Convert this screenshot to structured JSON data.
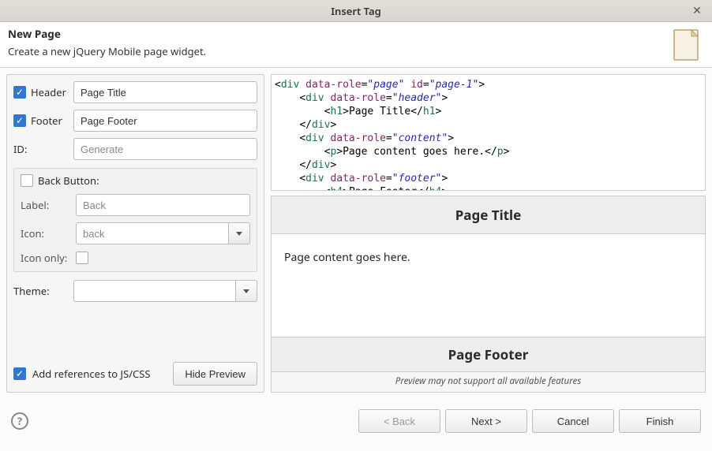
{
  "titlebar": {
    "title": "Insert Tag"
  },
  "banner": {
    "heading": "New Page",
    "subtext": "Create a new jQuery Mobile page widget."
  },
  "form": {
    "header_label": "Header",
    "header_value": "Page Title",
    "footer_label": "Footer",
    "footer_value": "Page Footer",
    "id_label": "ID:",
    "id_placeholder": "Generate",
    "backbutton_label": "Back Button:",
    "label_label": "Label:",
    "label_placeholder": "Back",
    "icon_label": "Icon:",
    "icon_value": "back",
    "icononly_label": "Icon only:",
    "theme_label": "Theme:",
    "theme_value": "",
    "add_refs_label": "Add references to JS/CSS",
    "hide_preview_label": "Hide Preview"
  },
  "code": {
    "l1_attr1": "data-role",
    "l1_val1": "page",
    "l1_attr2": "id",
    "l1_val2": "page-1",
    "l2_val": "header",
    "l3_txt": "Page Title",
    "l5_val": "content",
    "l6_txt": "Page content goes here.",
    "l8_val": "footer",
    "l9_txt": "Page Footer"
  },
  "preview": {
    "header": "Page Title",
    "content": "Page content goes here.",
    "footer": "Page Footer",
    "note": "Preview may not support all available features"
  },
  "buttons": {
    "back": "< Back",
    "next": "Next >",
    "cancel": "Cancel",
    "finish": "Finish"
  }
}
